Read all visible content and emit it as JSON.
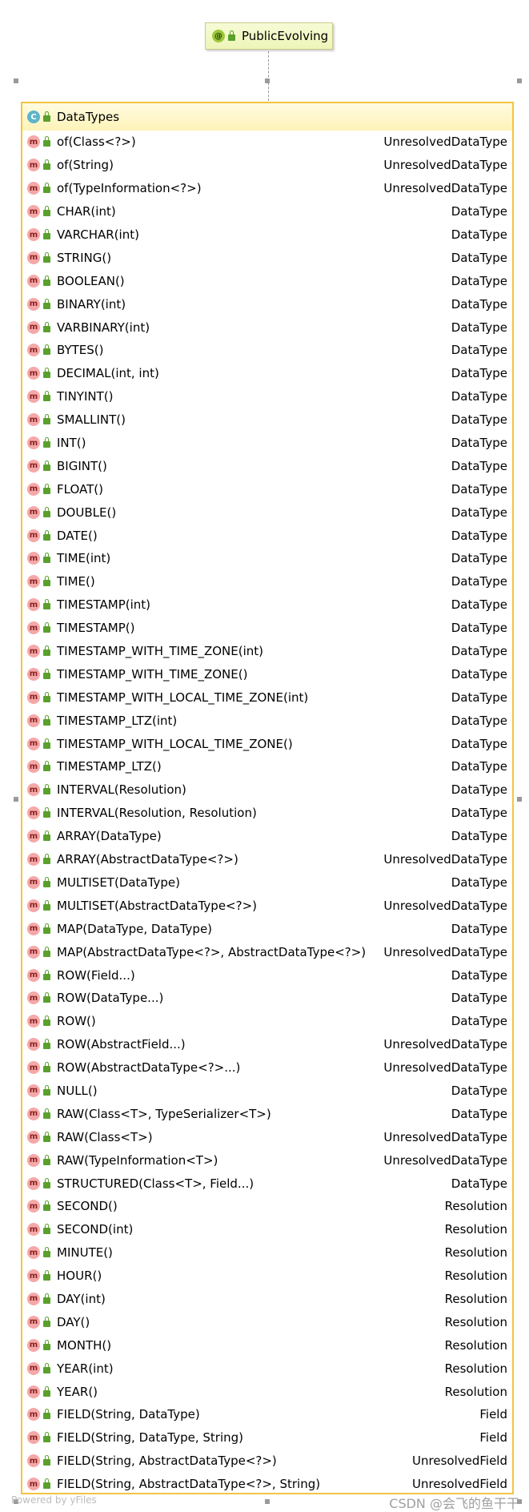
{
  "annotation": {
    "icon": "@",
    "label": "PublicEvolving"
  },
  "class": {
    "icon": "C",
    "name": "DataTypes"
  },
  "members": [
    {
      "sig": "of(Class<?>)",
      "type": "UnresolvedDataType"
    },
    {
      "sig": "of(String)",
      "type": "UnresolvedDataType"
    },
    {
      "sig": "of(TypeInformation<?>)",
      "type": "UnresolvedDataType"
    },
    {
      "sig": "CHAR(int)",
      "type": "DataType"
    },
    {
      "sig": "VARCHAR(int)",
      "type": "DataType"
    },
    {
      "sig": "STRING()",
      "type": "DataType"
    },
    {
      "sig": "BOOLEAN()",
      "type": "DataType"
    },
    {
      "sig": "BINARY(int)",
      "type": "DataType"
    },
    {
      "sig": "VARBINARY(int)",
      "type": "DataType"
    },
    {
      "sig": "BYTES()",
      "type": "DataType"
    },
    {
      "sig": "DECIMAL(int, int)",
      "type": "DataType"
    },
    {
      "sig": "TINYINT()",
      "type": "DataType"
    },
    {
      "sig": "SMALLINT()",
      "type": "DataType"
    },
    {
      "sig": "INT()",
      "type": "DataType"
    },
    {
      "sig": "BIGINT()",
      "type": "DataType"
    },
    {
      "sig": "FLOAT()",
      "type": "DataType"
    },
    {
      "sig": "DOUBLE()",
      "type": "DataType"
    },
    {
      "sig": "DATE()",
      "type": "DataType"
    },
    {
      "sig": "TIME(int)",
      "type": "DataType"
    },
    {
      "sig": "TIME()",
      "type": "DataType"
    },
    {
      "sig": "TIMESTAMP(int)",
      "type": "DataType"
    },
    {
      "sig": "TIMESTAMP()",
      "type": "DataType"
    },
    {
      "sig": "TIMESTAMP_WITH_TIME_ZONE(int)",
      "type": "DataType"
    },
    {
      "sig": "TIMESTAMP_WITH_TIME_ZONE()",
      "type": "DataType"
    },
    {
      "sig": "TIMESTAMP_WITH_LOCAL_TIME_ZONE(int)",
      "type": "DataType"
    },
    {
      "sig": "TIMESTAMP_LTZ(int)",
      "type": "DataType"
    },
    {
      "sig": "TIMESTAMP_WITH_LOCAL_TIME_ZONE()",
      "type": "DataType"
    },
    {
      "sig": "TIMESTAMP_LTZ()",
      "type": "DataType"
    },
    {
      "sig": "INTERVAL(Resolution)",
      "type": "DataType"
    },
    {
      "sig": "INTERVAL(Resolution, Resolution)",
      "type": "DataType"
    },
    {
      "sig": "ARRAY(DataType)",
      "type": "DataType"
    },
    {
      "sig": "ARRAY(AbstractDataType<?>)",
      "type": "UnresolvedDataType"
    },
    {
      "sig": "MULTISET(DataType)",
      "type": "DataType"
    },
    {
      "sig": "MULTISET(AbstractDataType<?>)",
      "type": "UnresolvedDataType"
    },
    {
      "sig": "MAP(DataType, DataType)",
      "type": "DataType"
    },
    {
      "sig": "MAP(AbstractDataType<?>, AbstractDataType<?>)",
      "type": "UnresolvedDataType"
    },
    {
      "sig": "ROW(Field...)",
      "type": "DataType"
    },
    {
      "sig": "ROW(DataType...)",
      "type": "DataType"
    },
    {
      "sig": "ROW()",
      "type": "DataType"
    },
    {
      "sig": "ROW(AbstractField...)",
      "type": "UnresolvedDataType"
    },
    {
      "sig": "ROW(AbstractDataType<?>...)",
      "type": "UnresolvedDataType"
    },
    {
      "sig": "NULL()",
      "type": "DataType"
    },
    {
      "sig": "RAW(Class<T>, TypeSerializer<T>)",
      "type": "DataType"
    },
    {
      "sig": "RAW(Class<T>)",
      "type": "UnresolvedDataType"
    },
    {
      "sig": "RAW(TypeInformation<T>)",
      "type": "UnresolvedDataType"
    },
    {
      "sig": "STRUCTURED(Class<T>, Field...)",
      "type": "DataType"
    },
    {
      "sig": "SECOND()",
      "type": "Resolution"
    },
    {
      "sig": "SECOND(int)",
      "type": "Resolution"
    },
    {
      "sig": "MINUTE()",
      "type": "Resolution"
    },
    {
      "sig": "HOUR()",
      "type": "Resolution"
    },
    {
      "sig": "DAY(int)",
      "type": "Resolution"
    },
    {
      "sig": "DAY()",
      "type": "Resolution"
    },
    {
      "sig": "MONTH()",
      "type": "Resolution"
    },
    {
      "sig": "YEAR(int)",
      "type": "Resolution"
    },
    {
      "sig": "YEAR()",
      "type": "Resolution"
    },
    {
      "sig": "FIELD(String, DataType)",
      "type": "Field"
    },
    {
      "sig": "FIELD(String, DataType, String)",
      "type": "Field"
    },
    {
      "sig": "FIELD(String, AbstractDataType<?>)",
      "type": "UnresolvedField"
    },
    {
      "sig": "FIELD(String, AbstractDataType<?>, String)",
      "type": "UnresolvedField"
    }
  ],
  "member_icon": "m",
  "footer": {
    "powered_by": "Powered by yFiles",
    "watermark": "CSDN @会飞的鱼干干"
  },
  "colors": {
    "class_border": "#f2c443",
    "method_icon": "#f5a8a8",
    "class_icon": "#5fb4c8",
    "public_lock": "#5aa02c"
  }
}
